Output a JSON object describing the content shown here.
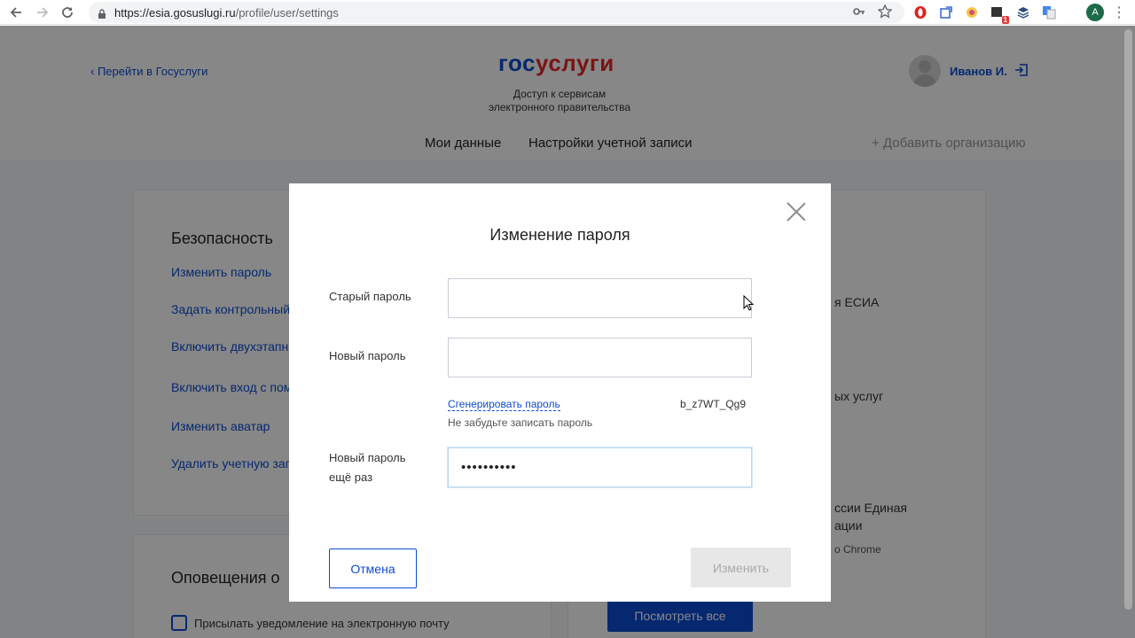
{
  "browser": {
    "url_host": "https://esia.gosuslugi.ru",
    "url_path": "/profile/user/settings",
    "profile_initial": "A",
    "ext_badge": "1"
  },
  "header": {
    "back_link": "Перейти в Госуслуги",
    "logo_part1": "гос",
    "logo_part2": "услуги",
    "tagline_line1": "Доступ к сервисам",
    "tagline_line2": "электронного правительства",
    "user_name": "Иванов И."
  },
  "tabs": {
    "my_data": "Мои данные",
    "account_settings": "Настройки учетной записи",
    "add_org": "+ Добавить организацию"
  },
  "security": {
    "title": "Безопасность",
    "links": [
      "Изменить пароль",
      "Задать контрольный",
      "Включить двухэтапн",
      "Включить вход с пом",
      "Изменить аватар",
      "Удалить учетную зап"
    ]
  },
  "notifications": {
    "title": "Оповещения о",
    "email_checkbox_label": "Присылать уведомление на электронную почту"
  },
  "right_panel": {
    "text1": "я ЕСИА",
    "text2": "ых услуг",
    "text3": "ссии Единая",
    "text4": "ации",
    "text5": "o Chrome",
    "see_all": "Посмотреть все"
  },
  "modal": {
    "title": "Изменение пароля",
    "old_password_label": "Старый пароль",
    "old_password_value": "",
    "new_password_label": "Новый пароль",
    "new_password_value": "",
    "generate_link": "Сгенерировать пароль",
    "generated_value": "b_z7WT_Qg9",
    "generate_hint": "Не забудьте записать пароль",
    "repeat_label_line1": "Новый пароль",
    "repeat_label_line2": "ещё раз",
    "repeat_value": "••••••••••",
    "cancel": "Отмена",
    "submit": "Изменить"
  }
}
